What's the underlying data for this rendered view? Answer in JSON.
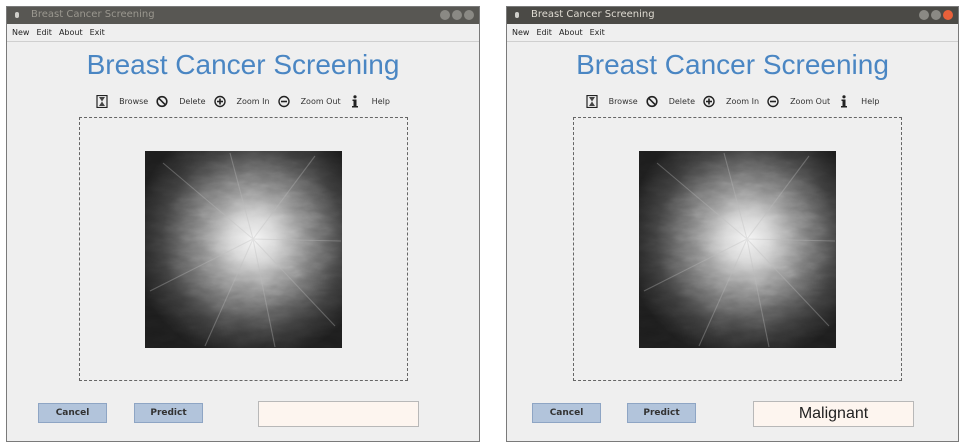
{
  "windows": [
    {
      "title": "Breast Cancer Screening",
      "menu": [
        "New",
        "Edit",
        "About",
        "Exit"
      ],
      "heading": "Breast Cancer Screening",
      "toolbar": [
        "Browse",
        "Delete",
        "Zoom In",
        "Zoom Out",
        "Help"
      ],
      "buttons": {
        "cancel": "Cancel",
        "predict": "Predict"
      },
      "result": ""
    },
    {
      "title": "Breast Cancer Screening",
      "menu": [
        "New",
        "Edit",
        "About",
        "Exit"
      ],
      "heading": "Breast Cancer Screening",
      "toolbar": [
        "Browse",
        "Delete",
        "Zoom In",
        "Zoom Out",
        "Help"
      ],
      "buttons": {
        "cancel": "Cancel",
        "predict": "Predict"
      },
      "result": "Malignant"
    }
  ],
  "icons": [
    "hourglass-icon",
    "no-entry-icon",
    "zoom-in-icon",
    "zoom-out-icon",
    "info-icon"
  ],
  "colors": {
    "heading": "#4a86c3",
    "button": "#b2c4db",
    "result_bg": "#fdf5ef",
    "titlebar": "#4b4a46"
  }
}
